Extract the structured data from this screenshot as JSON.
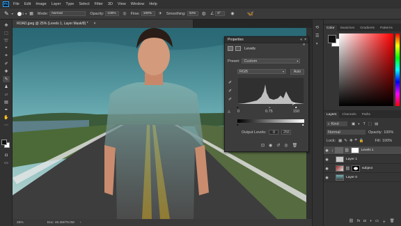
{
  "app": {
    "logo": "Ps"
  },
  "menu": [
    "File",
    "Edit",
    "Image",
    "Layer",
    "Type",
    "Select",
    "Filter",
    "3D",
    "View",
    "Window",
    "Help"
  ],
  "options": {
    "mode_label": "Mode:",
    "mode_value": "Normal",
    "opacity_label": "Opacity:",
    "opacity_value": "100%",
    "flow_label": "Flow:",
    "flow_value": "100%",
    "smoothing_label": "Smoothing:",
    "smoothing_value": "32%",
    "angle_value": "0°",
    "brush_size": "1"
  },
  "document": {
    "tab_title": "ROAD.jpeg @ 25% (Levels 1, Layer Mask/8) *",
    "zoom": "25%",
    "doc_size": "Doc: 46.3M/78.0M"
  },
  "properties": {
    "title": "Properties",
    "adjustment_name": "Levels",
    "preset_label": "Preset:",
    "preset_value": "Custom",
    "channel_value": "RGB",
    "auto_label": "Auto",
    "input_black": "0",
    "input_gamma": "0.75",
    "input_white": "150",
    "output_label": "Output Levels:",
    "output_black": "0",
    "output_white": "255"
  },
  "color_panel": {
    "tabs": [
      "Color",
      "Swatches",
      "Gradients",
      "Patterns"
    ],
    "foreground": "#111111",
    "background": "#ffffff",
    "hue": "#ff0000"
  },
  "layers_panel": {
    "tabs": [
      "Layers",
      "Channels",
      "Paths"
    ],
    "kind_label": "Kind",
    "blend_mode": "Normal",
    "opacity_label": "Opacity:",
    "opacity_value": "100%",
    "lock_label": "Lock:",
    "fill_label": "Fill:",
    "fill_value": "100%",
    "layers": [
      {
        "name": "Levels 1"
      },
      {
        "name": "Layer 1"
      },
      {
        "name": "subject"
      },
      {
        "name": "Layer 0"
      }
    ]
  },
  "colors": {
    "sky": "#3f8f9a",
    "road": "#3a3a3a",
    "line_yellow": "#e8b400",
    "accent": "#2d6fd1"
  }
}
